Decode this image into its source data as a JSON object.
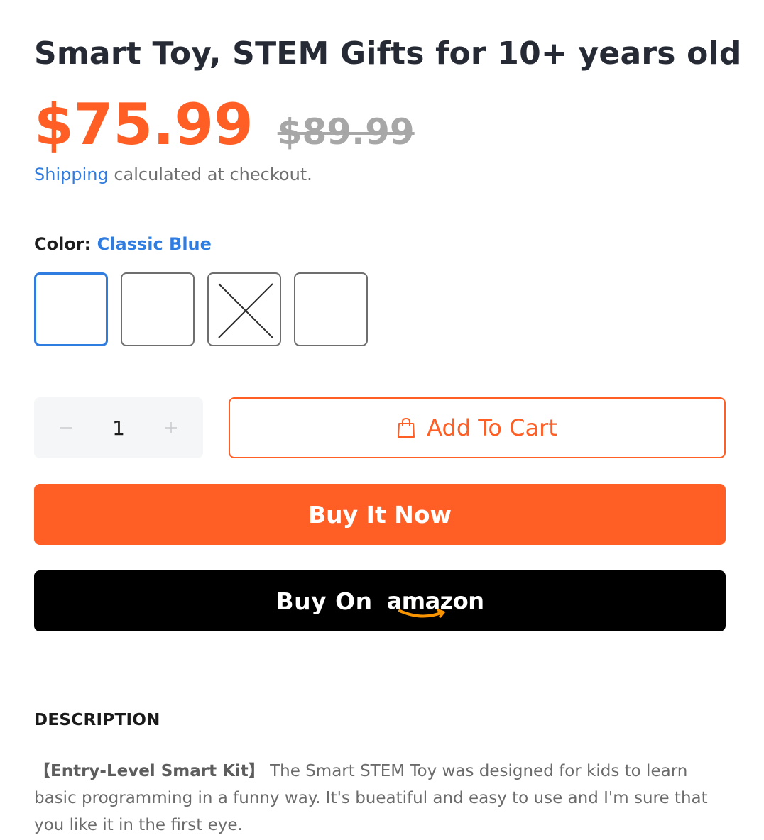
{
  "product": {
    "title": "Smart Toy, STEM Gifts for 10+ years old",
    "price_current": "$75.99",
    "price_original": "$89.99",
    "shipping_link": "Shipping",
    "shipping_text": " calculated at checkout."
  },
  "variant": {
    "label": "Color:",
    "selected_value": "Classic Blue",
    "swatches": [
      {
        "state": "selected"
      },
      {
        "state": "available"
      },
      {
        "state": "unavailable"
      },
      {
        "state": "available"
      }
    ]
  },
  "quantity": {
    "value": "1",
    "decrease_icon": "minus-icon",
    "increase_icon": "plus-icon"
  },
  "actions": {
    "add_to_cart_label": "Add To Cart",
    "add_to_cart_icon": "shopping-bag-icon",
    "buy_now_label": "Buy It Now",
    "buy_on_label": "Buy On",
    "amazon_logo_text": "amazon"
  },
  "description": {
    "heading": "DESCRIPTION",
    "lead": "【Entry-Level Smart Kit】",
    "body": "The Smart STEM Toy was designed for kids to learn basic programming in a funny way. It's bueatiful and easy to use and I'm sure that you like it in the first eye."
  },
  "colors": {
    "accent": "#ff5e24",
    "link": "#2f7de1",
    "title": "#262a35",
    "muted": "#a7a7a7",
    "amazon_smile": "#f79400"
  }
}
